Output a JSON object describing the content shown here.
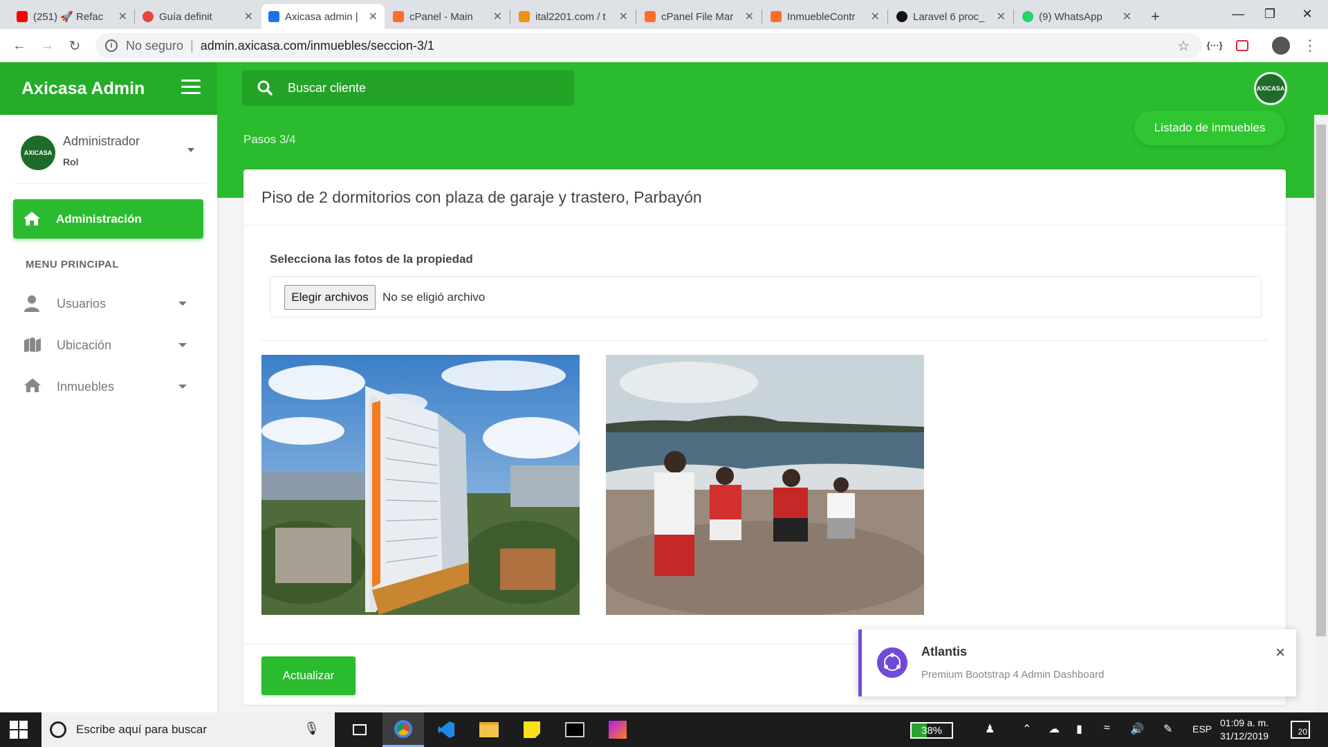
{
  "browser": {
    "tabs": [
      {
        "label": "(251) 🚀 Refac",
        "color": "#ff0000"
      },
      {
        "label": "Guía definit",
        "color": "#e8453c"
      },
      {
        "label": "Axicasa admin |",
        "color": "#1a73e8",
        "active": true
      },
      {
        "label": "cPanel - Main",
        "color": "#ff6c2c"
      },
      {
        "label": "ital2201.com / t",
        "color": "#f29111"
      },
      {
        "label": "cPanel File Mar",
        "color": "#ff6c2c"
      },
      {
        "label": "InmuebleContr",
        "color": "#ff6c2c"
      },
      {
        "label": "Laravel 6 proc_",
        "color": "#111111"
      },
      {
        "label": "(9) WhatsApp",
        "color": "#25d366"
      }
    ],
    "new_tab": "+",
    "security_label": "No seguro",
    "url": "admin.axicasa.com/inmuebles/seccion-3/1"
  },
  "app": {
    "brand": "Axicasa Admin",
    "search_placeholder": "Buscar cliente",
    "logo_text": "AXICASA"
  },
  "sidebar": {
    "user_name": "Administrador",
    "user_role": "Rol",
    "active_item": "Administración",
    "menu_heading": "MENU PRINCIPAL",
    "items": [
      {
        "label": "Usuarios",
        "icon": "user-icon"
      },
      {
        "label": "Ubicación",
        "icon": "map-icon"
      },
      {
        "label": "Inmuebles",
        "icon": "home-icon"
      }
    ]
  },
  "main": {
    "steps": "Pasos 3/4",
    "list_button": "Listado de inmuebles",
    "title": "Piso de 2 dormitorios con plaza de garaje y trastero, Parbayón",
    "photos_label": "Selecciona las fotos de la propiedad",
    "file_button": "Elegir archivos",
    "file_status": "No se eligió archivo",
    "photos": [
      "building-photo",
      "beach-photo"
    ],
    "update_button": "Actualizar"
  },
  "toast": {
    "title": "Atlantis",
    "message": "Premium Bootstrap 4 Admin Dashboard",
    "close": "×"
  },
  "taskbar": {
    "search_placeholder": "Escribe aquí para buscar",
    "battery": "38%",
    "language": "ESP",
    "time": "01:09 a. m.",
    "date": "31/12/2019",
    "notifications": "20"
  },
  "colors": {
    "primary_green": "#2bbb2e",
    "toast_accent": "#6f4bd8"
  }
}
